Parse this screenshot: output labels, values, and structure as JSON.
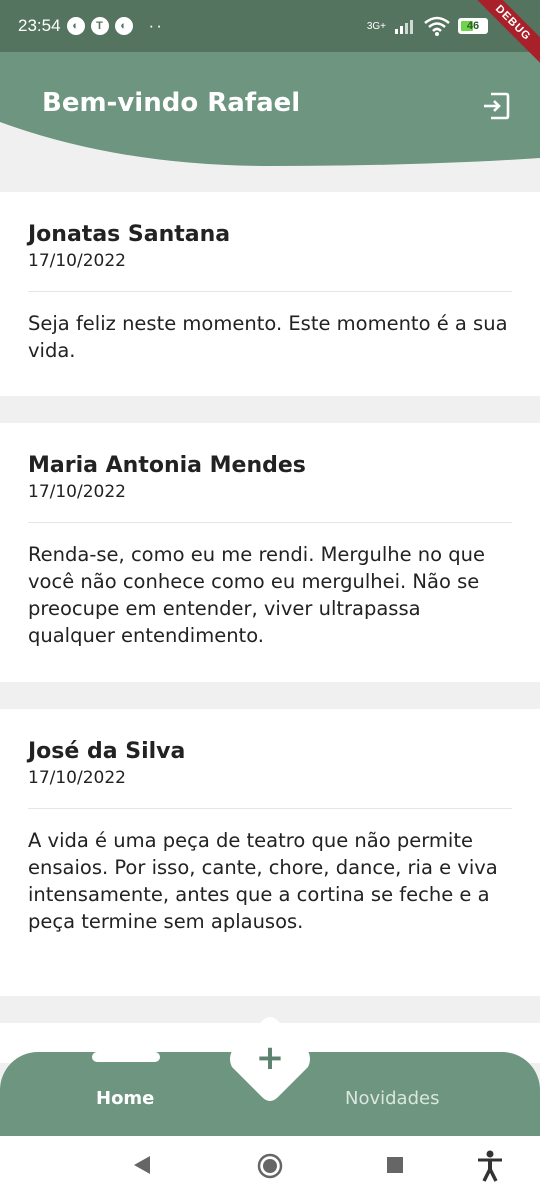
{
  "status_bar": {
    "time": "23:54",
    "network": "3G+",
    "battery": "46",
    "debug_banner": "DEBUG"
  },
  "header": {
    "title": "Bem-vindo Rafael",
    "background": "#6d9580",
    "logout_icon": "logout-icon"
  },
  "posts": [
    {
      "author": "Jonatas Santana",
      "date": "17/10/2022",
      "message": "Seja feliz neste momento. Este momento é a sua vida."
    },
    {
      "author": "Maria Antonia Mendes",
      "date": "17/10/2022",
      "message": "Renda-se, como eu me rendi. Mergulhe no que você não conhece como eu mergulhei. Não se preocupe em entender, viver ultrapassa qualquer entendimento."
    },
    {
      "author": "José da Silva",
      "date": "17/10/2022",
      "message": "A vida é uma peça de teatro que não permite ensaios. Por isso, cante, chore, dance, ria e viva intensamente, antes que a cortina se feche e a peça termine sem aplausos."
    }
  ],
  "bottom_nav": {
    "home_label": "Home",
    "news_label": "Novidades",
    "fab_label": "+",
    "accent": "#6d9580"
  },
  "system_nav": {
    "back_icon": "back-icon",
    "home_icon": "home-circle-icon",
    "recents_icon": "recents-icon",
    "accessibility_icon": "accessibility-icon"
  }
}
